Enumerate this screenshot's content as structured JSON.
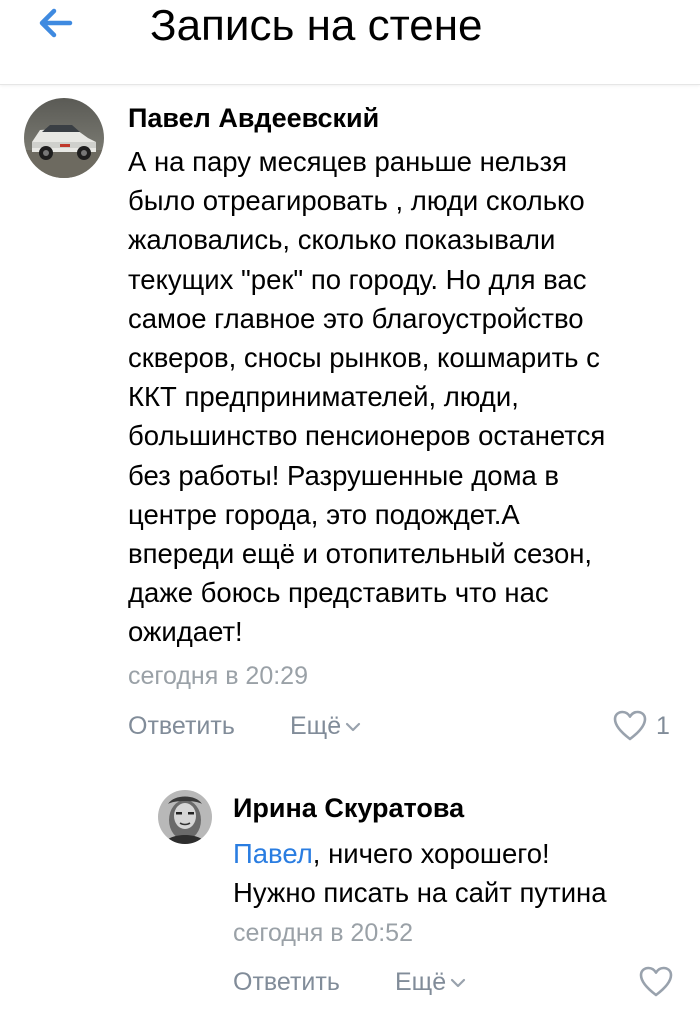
{
  "header": {
    "title": "Запись на стене",
    "back_icon": "arrow-left-icon",
    "accent_color": "#3f8ae0"
  },
  "comments": [
    {
      "author": "Павел Авдеевский",
      "avatar_icon": "car-avatar",
      "text": "А на пару месяцев раньше нельзя\nбыло отреагировать , люди сколько\nжаловались, сколько показывали\nтекущих \"рек\" по городу. Но для вас\nсамое главное это благоустройство\nскверов, сносы рынков, кошмарить с\nККТ предпринимателей, люди,\nбольшинство пенсионеров останется\nбез работы! Разрушенные дома в\nцентре города, это подождет.А\nвпереди ещё и отопительный сезон,\nдаже боюсь представить что нас\nожидает!",
      "timestamp": "сегодня в 20:29",
      "reply_label": "Ответить",
      "more_label": "Ещё",
      "like_icon": "heart-outline-icon",
      "like_count": "1"
    },
    {
      "author": "Ирина Скуратова",
      "avatar_icon": "portrait-avatar",
      "mention": "Павел",
      "text_after_mention": ", ничего хорошего!",
      "text_line2": "Нужно писать на сайт путина",
      "timestamp": "сегодня в 20:52",
      "reply_label": "Ответить",
      "more_label": "Ещё",
      "like_icon": "heart-outline-icon"
    }
  ],
  "colors": {
    "mention": "#2a7de1",
    "secondary_text": "#818c99",
    "timestamp": "#9aa1a7"
  }
}
